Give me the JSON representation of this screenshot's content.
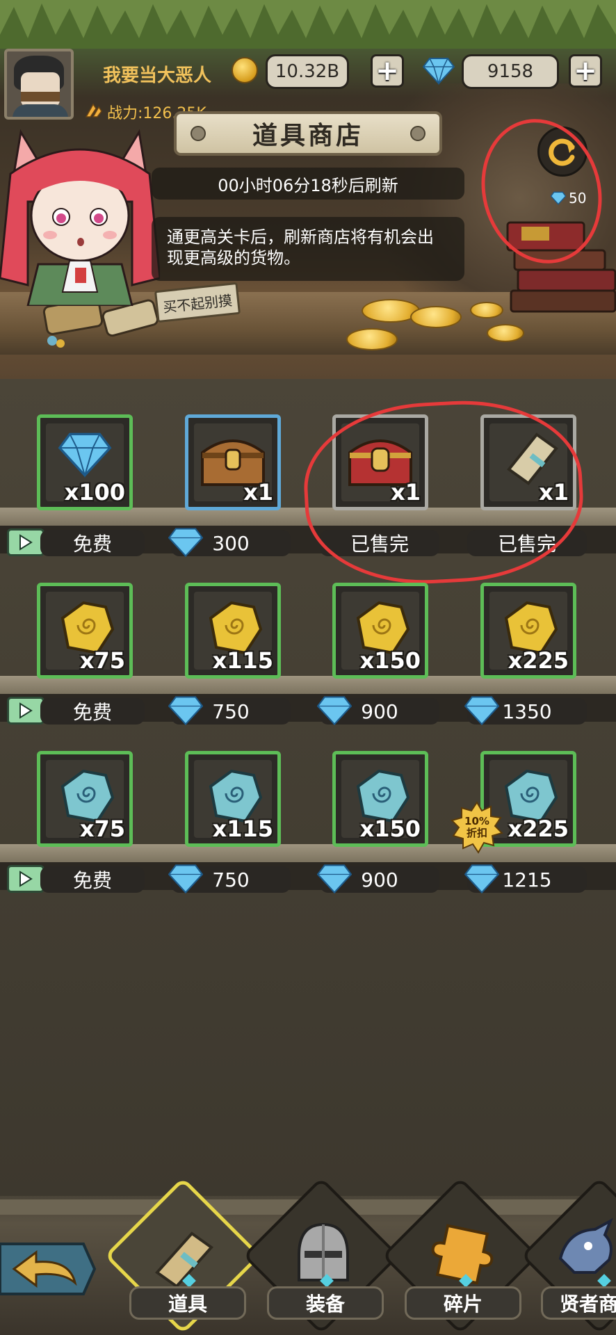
{
  "header": {
    "username": "我要当大恶人",
    "gold": "10.32B",
    "gems": "9158",
    "power_label": "战力:126.25K",
    "shop_title": "道具商店",
    "refresh_timer": "00小时06分18秒后刷新",
    "tip": "通更高关卡后，刷新商店将有机会出现更高级的货物。",
    "refresh_cost": "50",
    "buy_sign": "买不起别摸"
  },
  "rows": [
    {
      "items": [
        {
          "icon": "diamond-icon",
          "qty": "x100",
          "frame": "green",
          "price": "免费",
          "type": "ad"
        },
        {
          "icon": "wooden-chest-icon",
          "qty": "x1",
          "frame": "blue",
          "price": "300",
          "type": "gem"
        },
        {
          "icon": "red-chest-icon",
          "qty": "x1",
          "frame": "gray",
          "price": "已售完",
          "type": "sold"
        },
        {
          "icon": "scroll-icon",
          "qty": "x1",
          "frame": "gray",
          "price": "已售完",
          "type": "sold"
        }
      ]
    },
    {
      "items": [
        {
          "icon": "gold-ore-icon",
          "qty": "x75",
          "frame": "green",
          "price": "免费",
          "type": "ad"
        },
        {
          "icon": "gold-ore-icon",
          "qty": "x115",
          "frame": "green",
          "price": "750",
          "type": "gem"
        },
        {
          "icon": "gold-ore-icon",
          "qty": "x150",
          "frame": "green",
          "price": "900",
          "type": "gem"
        },
        {
          "icon": "gold-ore-icon",
          "qty": "x225",
          "frame": "green",
          "price": "1350",
          "type": "gem"
        }
      ]
    },
    {
      "items": [
        {
          "icon": "blue-ore-icon",
          "qty": "x75",
          "frame": "green",
          "price": "免费",
          "type": "ad"
        },
        {
          "icon": "blue-ore-icon",
          "qty": "x115",
          "frame": "green",
          "price": "750",
          "type": "gem"
        },
        {
          "icon": "blue-ore-icon",
          "qty": "x150",
          "frame": "green",
          "price": "900",
          "type": "gem"
        },
        {
          "icon": "blue-ore-icon",
          "qty": "x225",
          "frame": "green",
          "price": "1215",
          "type": "gem",
          "badge": "10%\n折扣"
        }
      ]
    }
  ],
  "discount": {
    "line1": "10%",
    "line2": "折扣"
  },
  "nav": {
    "items": [
      {
        "label": "道具",
        "icon": "scroll-icon",
        "active": true
      },
      {
        "label": "装备",
        "icon": "helmet-icon",
        "active": false
      },
      {
        "label": "碎片",
        "icon": "puzzle-piece-icon",
        "active": false
      },
      {
        "label": "贤者商",
        "icon": "dragon-icon",
        "active": false
      }
    ]
  },
  "colors": {
    "frame_green": "#5dbd57",
    "frame_blue": "#5fa9d8",
    "frame_gray": "#aaa9a3",
    "annotation_red": "#e63a3a",
    "gold_text": "#f1c25c"
  }
}
